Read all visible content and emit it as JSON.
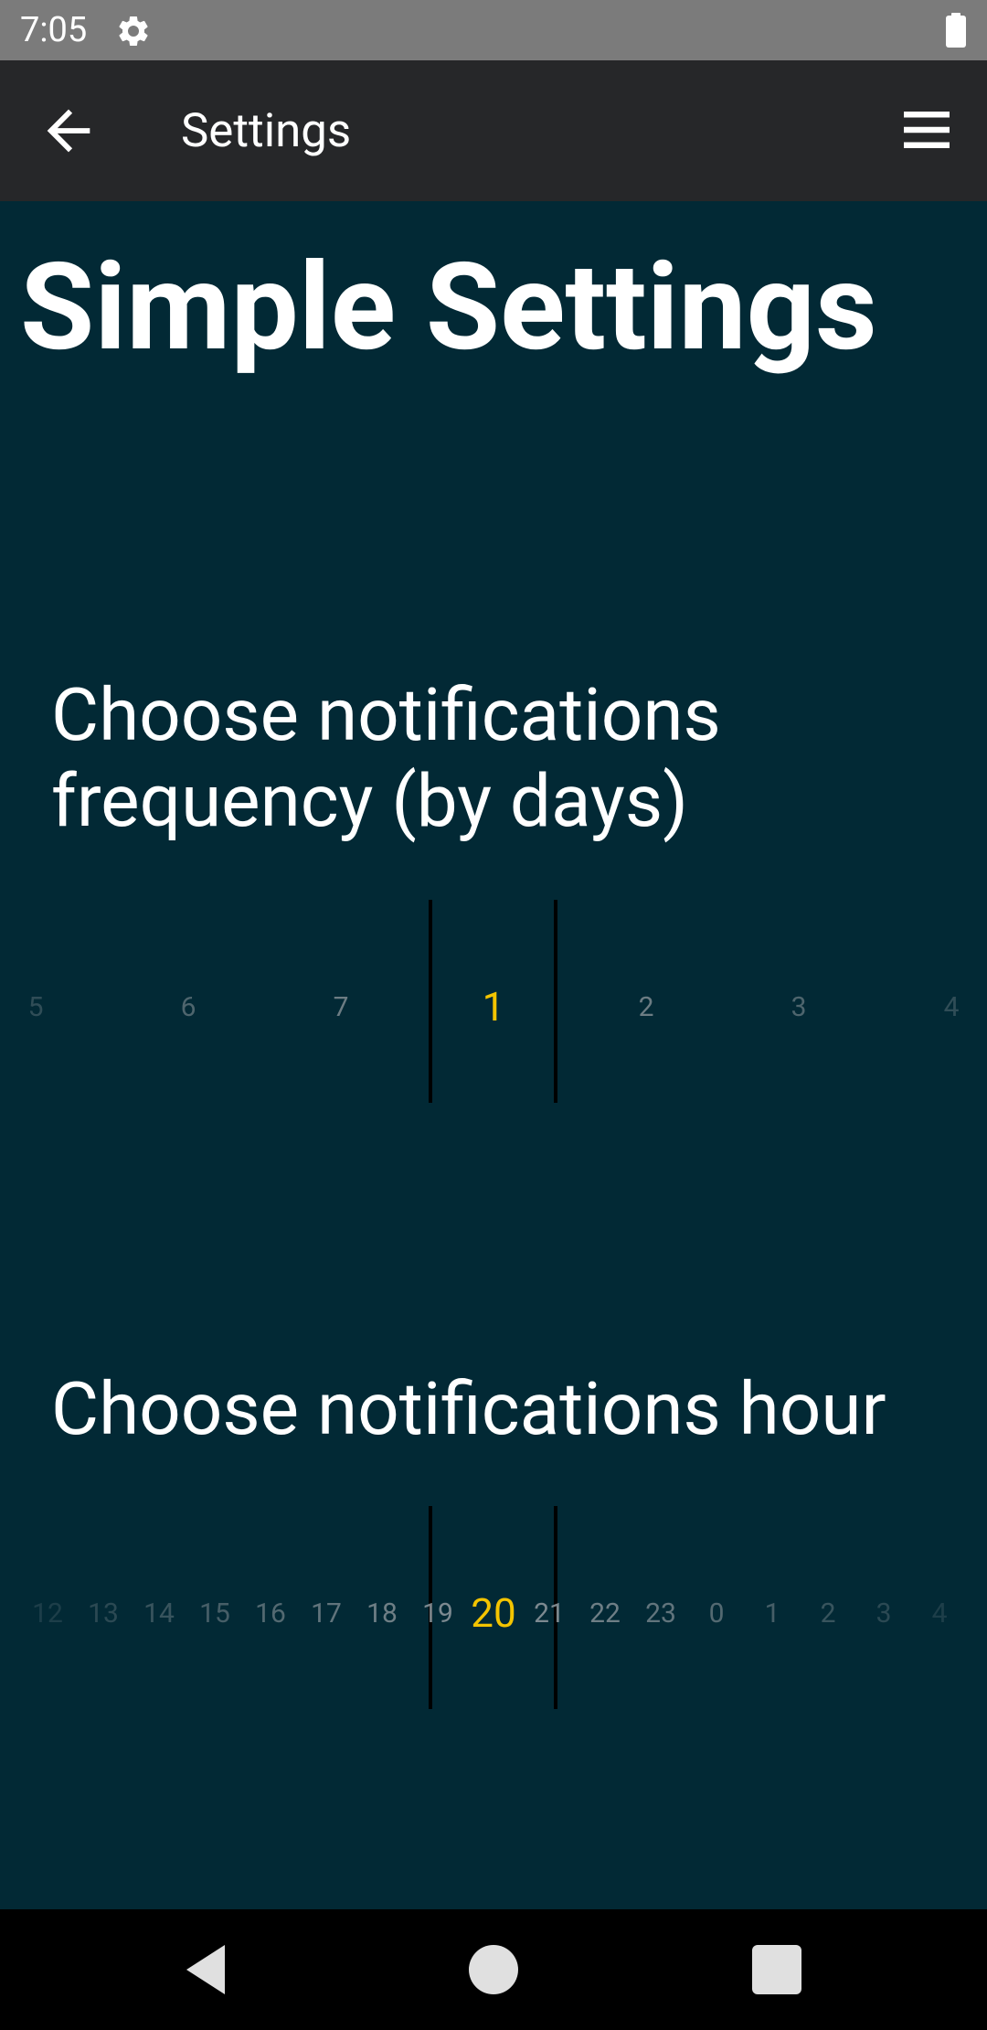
{
  "status_bar": {
    "time": "7:05",
    "icons": [
      "gear-icon",
      "battery-icon"
    ]
  },
  "app_bar": {
    "title": "Settings",
    "back_icon": "arrow-left-icon",
    "menu_icon": "hamburger-menu-icon"
  },
  "page": {
    "title": "Simple Settings"
  },
  "frequency": {
    "heading": "Choose notifications frequency (by days)",
    "items": [
      "5",
      "6",
      "7",
      "1",
      "2",
      "3",
      "4"
    ],
    "selected": "1"
  },
  "hour": {
    "heading": "Choose notifications hour",
    "items": [
      "12",
      "13",
      "14",
      "15",
      "16",
      "17",
      "18",
      "19",
      "20",
      "21",
      "22",
      "23",
      "0",
      "1",
      "2",
      "3",
      "4"
    ],
    "selected": "20"
  },
  "colors": {
    "background": "#022935",
    "app_bar": "#262729",
    "status_bar": "#7b7b7b",
    "accent": "#f4c400"
  },
  "nav_bar": {
    "icons": [
      "back-triangle-icon",
      "home-circle-icon",
      "recents-square-icon"
    ]
  }
}
